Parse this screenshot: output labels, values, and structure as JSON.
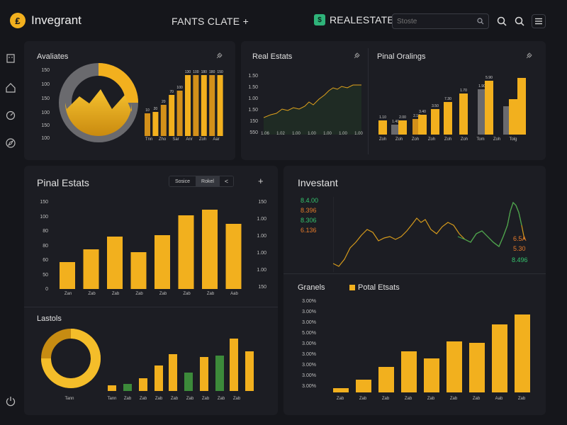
{
  "app": {
    "brand_name": "Invegrant",
    "brand_glyph": "₤",
    "center_title": "FANTS CLATE +",
    "real_estate_label": "REALESTATE",
    "search_placeholder": "Stoste",
    "colors": {
      "accent": "#f2b01e",
      "green": "#2fb37a",
      "bg": "#15161b",
      "panel": "#1c1d23"
    }
  },
  "header_icons": [
    "search-icon",
    "magnifier-icon",
    "menu-icon"
  ],
  "sidebar_icons": [
    "building-icon",
    "house-icon",
    "gauge-icon",
    "compass-icon",
    "power-icon"
  ],
  "panel_availates": {
    "title": "Avaliates",
    "y_ticks": [
      "150",
      "100",
      "150",
      "100",
      "150",
      "100"
    ],
    "x_ticks": [
      "Tnn",
      "Zho",
      "Sar",
      "Anr",
      "Zoh",
      "Aar"
    ],
    "bar_labels": [
      "10",
      "20",
      "20",
      "70",
      "100",
      "130",
      "100",
      "180",
      "180",
      "150"
    ]
  },
  "panel_real_estats": {
    "title": "Real Estats",
    "y_ticks": [
      "1.50",
      "1.50",
      "1.00",
      "1.50",
      "150",
      "550"
    ],
    "x_ticks": [
      "1.06",
      "1.02",
      "1.00",
      "1.00",
      "1.00",
      "1.00",
      "1.00"
    ]
  },
  "panel_final_orallings": {
    "title": "Pinal Oralings",
    "x_ticks": [
      "Zoh",
      "Zoh",
      "Zoh",
      "Zoh",
      "Zoh",
      "Zoh",
      "Tom",
      "Zoh",
      "Tolg"
    ],
    "bar_labels": [
      "1.10",
      "1.40",
      "2.00",
      "2.10",
      "3.40",
      "3.50",
      "7.30",
      "1.70",
      "1.90",
      "5.90"
    ]
  },
  "panel_final_estats": {
    "title": "Pinal Estats",
    "tabs": [
      "Sosice",
      "Rokel"
    ],
    "tab_arrow": "<",
    "plus": "+",
    "y_ticks_left": [
      "150",
      "100",
      "80",
      "80",
      "60",
      "50",
      "0"
    ],
    "y_ticks_right": [
      "150",
      "1.00",
      "1.00",
      "1.00",
      "1.00",
      "150"
    ],
    "x_ticks": [
      "Zan",
      "Zab",
      "Zab",
      "Zab",
      "Zab",
      "Zab",
      "Zab",
      "Aab"
    ],
    "lower_title": "Lastols",
    "lower_x_ticks": [
      "Tann",
      "Tann",
      "Zab",
      "Zab",
      "Zab",
      "Zab",
      "Zab",
      "Zab",
      "Zab",
      "Zab"
    ]
  },
  "panel_investant": {
    "title": "Investant",
    "values_left": [
      "8.4.00",
      "8.396",
      "8.306",
      "6.136"
    ],
    "values_right": [
      "6.5A",
      "5.30",
      "8.496"
    ],
    "lower_title": "Granels",
    "legend": "Potal Etsats",
    "y_ticks": [
      "3.00%",
      "3.00%",
      "3.00%",
      "5.00%",
      "3.00%",
      "3.00%",
      "3.00%",
      "3.00%",
      "3.00%"
    ],
    "x_ticks": [
      "Zab",
      "Zab",
      "Zab",
      "Zab",
      "Zab",
      "Zab",
      "Zab",
      "Aab",
      "Zab"
    ]
  }
}
